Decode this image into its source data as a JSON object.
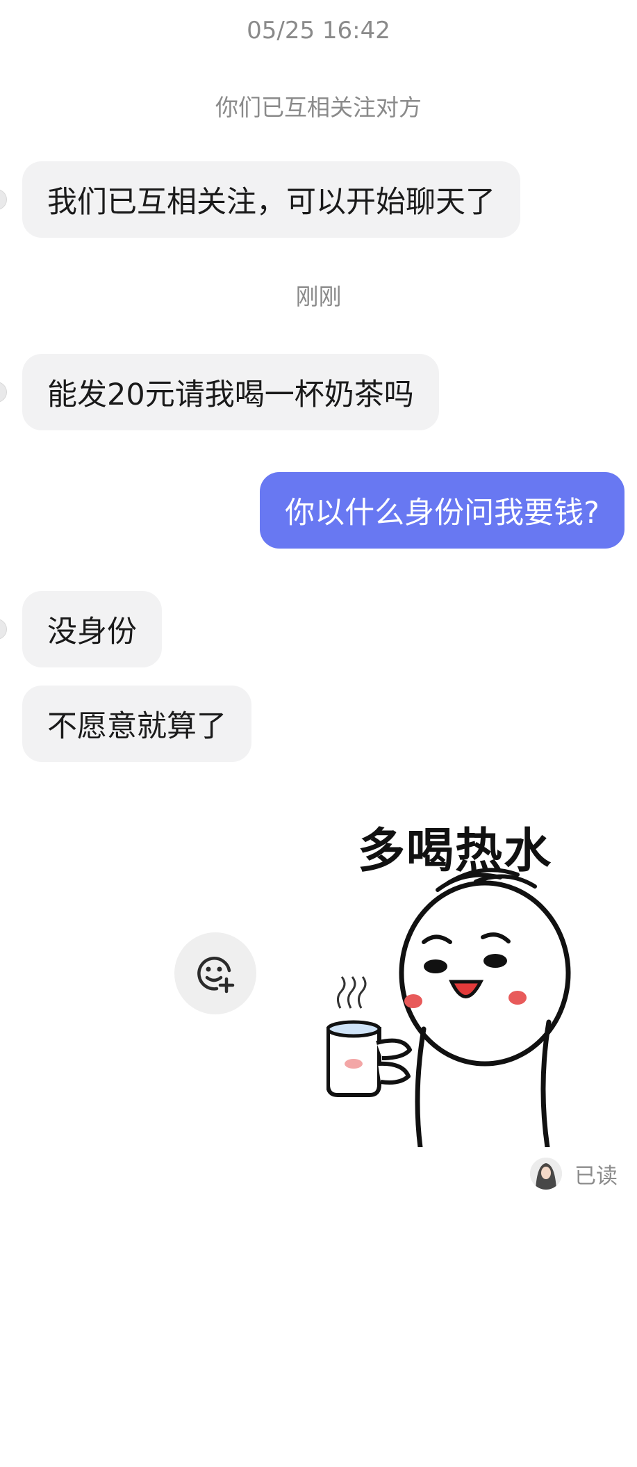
{
  "header": {
    "timestamp": "05/25 16:42",
    "system_notice": "你们已互相关注对方"
  },
  "messages": [
    {
      "side": "in",
      "text": "我们已互相关注，可以开始聊天了"
    },
    {
      "side": "in",
      "text": "能发20元请我喝一杯奶茶吗"
    },
    {
      "side": "out",
      "text": "你以什么身份问我要钱?"
    },
    {
      "side": "in",
      "text": "没身份"
    },
    {
      "side": "in",
      "text": "不愿意就算了"
    }
  ],
  "divider_time": "刚刚",
  "sticker": {
    "caption": "多喝热水",
    "icon": "cartoon-drinking-hot-water"
  },
  "add_sticker_button": {
    "icon": "emoji-add-icon"
  },
  "read_receipt": {
    "label": "已读",
    "icon": "avatar-icon"
  },
  "colors": {
    "incoming_bubble": "#f2f2f3",
    "outgoing_bubble": "#6878f2",
    "muted_text": "#8a8a8a"
  }
}
